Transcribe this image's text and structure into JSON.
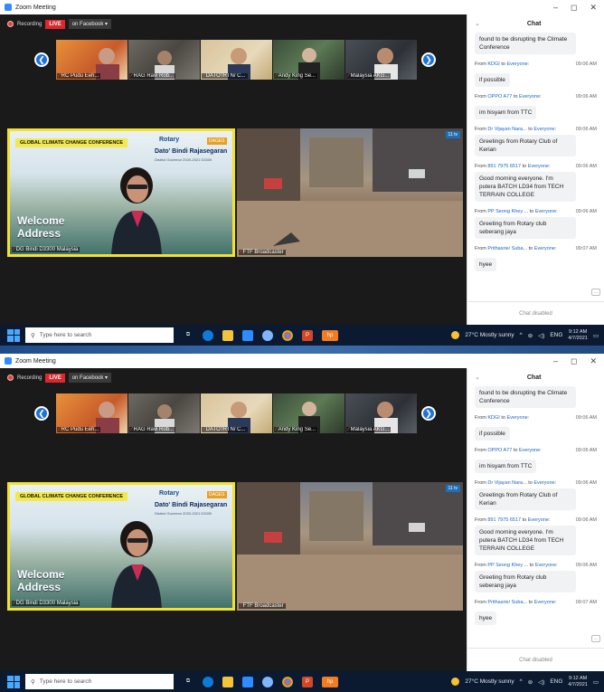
{
  "window": {
    "title": "Zoom Meeting",
    "minimize": "–",
    "maximize": "◻",
    "close": "✕"
  },
  "recording": {
    "label": "Recording",
    "live": "LIVE",
    "destination": "on Facebook ▾"
  },
  "thumbnails": [
    {
      "name": "RC Pudu Eeh..."
    },
    {
      "name": "RAG Ravi Rob..."
    },
    {
      "name": "DATO'/RTN/ C..."
    },
    {
      "name": "Andy King Se..."
    },
    {
      "name": "Malaysia AKG..."
    }
  ],
  "main_tiles": {
    "speaker": {
      "label": "DG Bindi D3300 Malaysia",
      "banner": "GLOBAL CLIMATE CHANGE CONFERENCE",
      "rotary": "Rotary",
      "dages": "DAGES",
      "name_top": "Dato' Bindi Rajasegaran",
      "name_sub": "District Governor 2020-2021 D3300",
      "welcome_line1": "Welcome",
      "welcome_line2": "Address"
    },
    "broadcast": {
      "label": "FTF Broadcaster",
      "badge": "11 tv"
    }
  },
  "chat": {
    "title": "Chat",
    "footer": "Chat disabled",
    "first_bubble": "found to be disrupting the Climate Conference",
    "messages": [
      {
        "from": "KDGI",
        "to": "Everyone:",
        "time": "09:06 AM",
        "text": "if possible"
      },
      {
        "from": "OPPO A77",
        "to": "Everyone:",
        "time": "09:06 AM",
        "text": "im hisyam from TTC"
      },
      {
        "from": "Dr Vijayan Nara...",
        "to": "Everyone:",
        "time": "09:06 AM",
        "text": "Greetings from Rotary Club of Kerian"
      },
      {
        "from": "891 7975 6517",
        "to": "Everyone:",
        "time": "09:06 AM",
        "text": "Good morning everyone. I'm putera BATCH LD34 from TECH TERRAIN COLLEGE"
      },
      {
        "from": "PP Seong Khey ...",
        "to": "Everyone:",
        "time": "09:06 AM",
        "text": "Greeting from Rotary club seberang jaya"
      },
      {
        "from": "Prithasrie/ Suba...",
        "to": "Everyone:",
        "time": "09:07 AM",
        "text": "hyee"
      }
    ],
    "from_word": "From",
    "to_word": "to"
  },
  "taskbar": {
    "search_placeholder": "Type here to search",
    "weather": "27°C  Mostly sunny",
    "language": "ENG",
    "time": "9:12 AM",
    "date": "4/7/2021"
  }
}
